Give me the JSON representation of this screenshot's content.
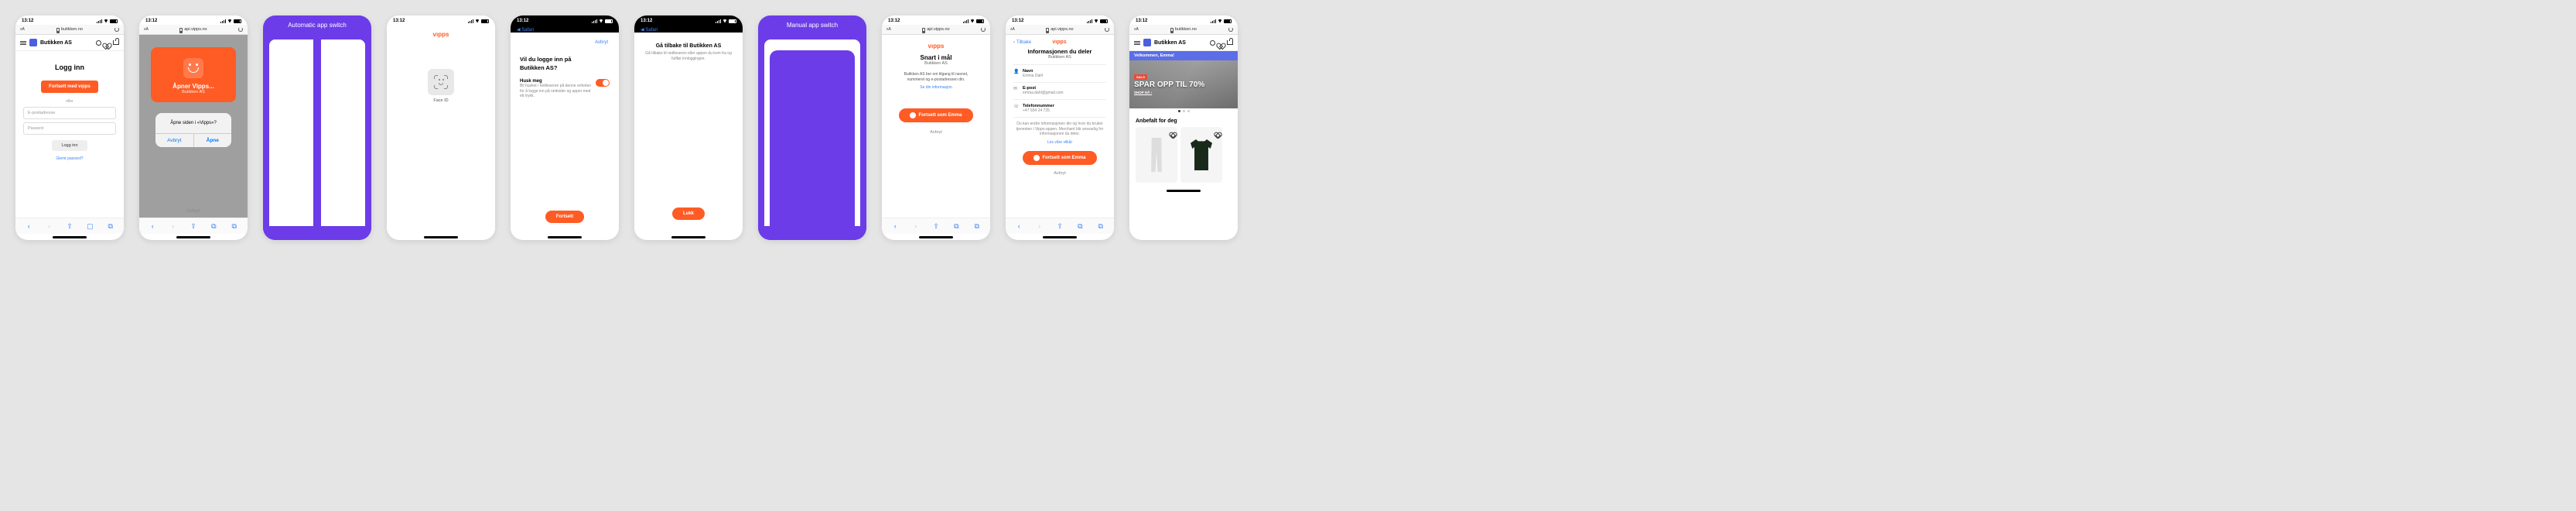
{
  "status": {
    "time": "13:12"
  },
  "urls": {
    "butikken": "butikken.no",
    "vipps": "api.vipps.no"
  },
  "urlbar": {
    "aa": "ᴀA"
  },
  "safari_back": "Safari",
  "appbar": {
    "title": "Butikken AS"
  },
  "s1": {
    "heading": "Logg inn",
    "vipps_btn": "Fortsett med vıpps",
    "or": "eller",
    "email_ph": "E-postadresse",
    "pass_ph": "Passord",
    "login_btn": "Logg inn",
    "forgot": "Glemt passord?"
  },
  "s2": {
    "opening": "Åpner Vipps...",
    "merchant": "Butikken AS",
    "alert_msg": "Åpne siden i «Vipps»?",
    "cancel": "Avbryt",
    "open": "Åpne",
    "bottom_cancel": "Avbryt"
  },
  "s3": {
    "banner": "Automatic app switch"
  },
  "s4": {
    "faceid": "Face ID"
  },
  "s5": {
    "cancel": "Avbryt",
    "title1": "Vil du logge inn på",
    "title2": "Butikken AS?",
    "remember": "Husk meg",
    "remember_desc": "Bli husket i nettleseren på denne enheten for å logge inn på nettsider og apper med ett trykk.",
    "continue": "Fortsett"
  },
  "s6": {
    "title": "Gå tilbake til Butikken AS",
    "desc": "Gå tilbake til nettleseren eller appen du kom fra og fullfør innloggingen.",
    "close": "Lukk"
  },
  "s7": {
    "banner": "Manual app switch"
  },
  "s8": {
    "title": "Snart i mål",
    "merchant": "Butikken AS",
    "desc1": "Butikken AS ber om tilgang til navnet,",
    "desc2": "nummeret og e-postadressen din.",
    "see_info": "Se din informasjon",
    "continue": "Fortsett som Emma",
    "cancel": "Avbryt"
  },
  "s9": {
    "back": "Tilbake",
    "title": "Informasjonen du deler",
    "merchant": "Butikken AS",
    "name_lbl": "Navn",
    "name_val": "Emma Dahl",
    "email_lbl": "E-post",
    "email_val": "emma.dahl@gmail.com",
    "phone_lbl": "Telefonnummer",
    "phone_val": "+47 934 24 725",
    "disclaimer": "Du kan endre informasjonen din og hvor du bruker tjenesten i Vipps-appen. Merchant blir ansvarlig for informasjonen du deler.",
    "terms": "Les våre vilkår",
    "continue": "Fortsett som Emma",
    "cancel": "Avbryt"
  },
  "s10": {
    "welcome": "Velkommen, Emma!",
    "sale": "SALG",
    "hero1": "SPAR OPP TIL 70%",
    "shop": "SHOP NÅ",
    "rec": "Anbefalt for deg"
  },
  "vipps_logo": "vıpps"
}
